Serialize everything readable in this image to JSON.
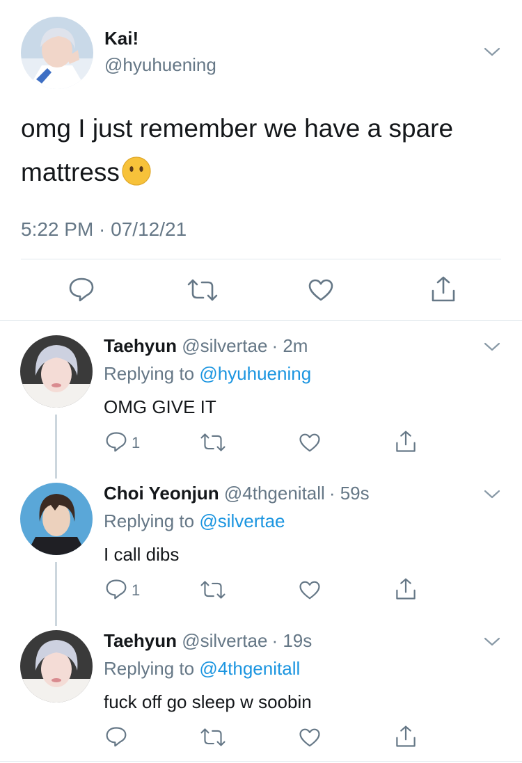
{
  "main_tweet": {
    "display_name": "Kai!",
    "handle": "@hyuhuening",
    "text_line1": "omg I just remember we have a spare",
    "text_line2": "mattress",
    "emoji": "speechless-face",
    "timestamp": "5:22 PM · 07/12/21"
  },
  "replies": [
    {
      "display_name": "Taehyun",
      "handle": "@silvertae",
      "time": "· 2m",
      "replying_label": "Replying to",
      "replying_to": "@hyuhuening",
      "text": "OMG GIVE IT",
      "reply_count": "1"
    },
    {
      "display_name": "Choi Yeonjun",
      "handle": "@4thgenitall",
      "time": "· 59s",
      "replying_label": "Replying to",
      "replying_to": "@silvertae",
      "text": "I call dibs",
      "reply_count": "1"
    },
    {
      "display_name": "Taehyun",
      "handle": "@silvertae",
      "time": "· 19s",
      "replying_label": "Replying to",
      "replying_to": "@4thgenitall",
      "text": "fuck off go sleep w soobin",
      "reply_count": ""
    }
  ],
  "icons": {
    "reply": "reply-icon",
    "retweet": "retweet-icon",
    "like": "heart-icon",
    "share": "share-icon",
    "more": "chevron-down-icon"
  },
  "colors": {
    "text": "#14171a",
    "muted": "#657786",
    "link": "#1b95e0",
    "divider": "#e1e8ed",
    "emoji": "#f7c23a"
  }
}
